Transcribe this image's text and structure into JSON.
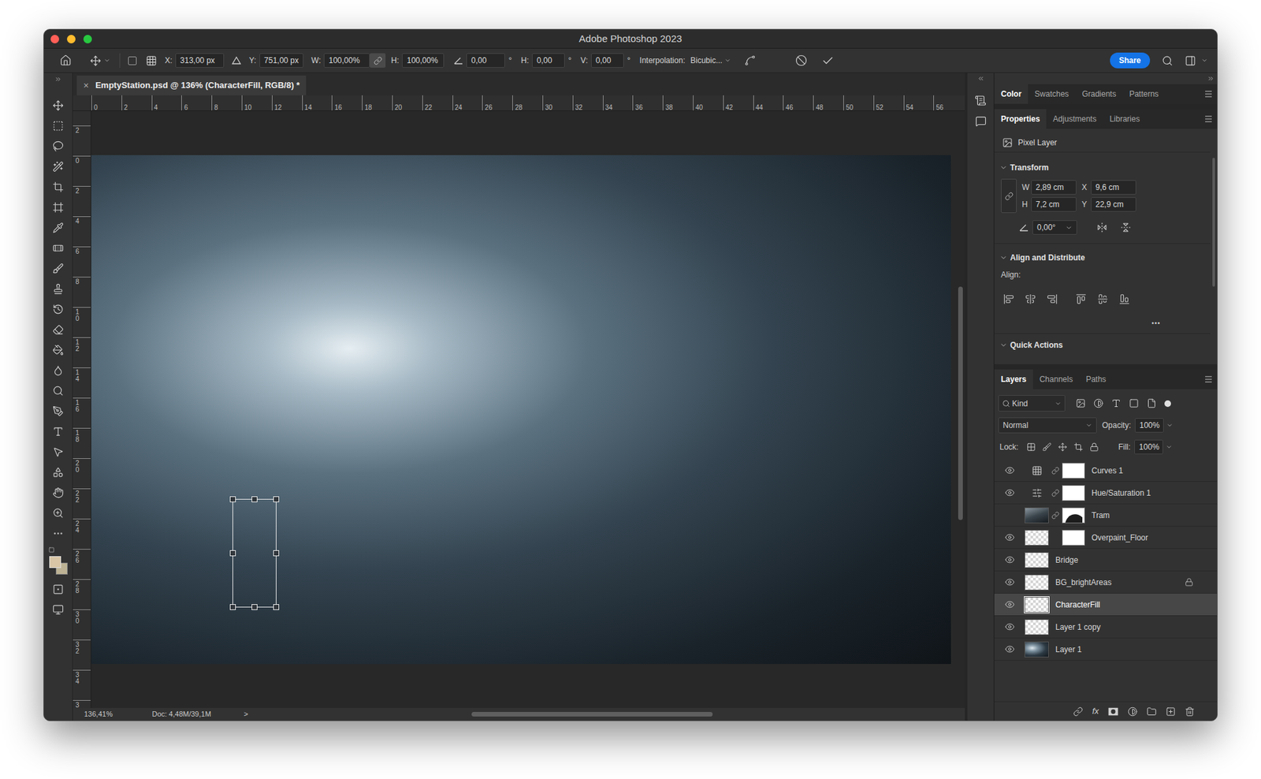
{
  "window": {
    "title": "Adobe Photoshop 2023",
    "controls": [
      {
        "color": "#ff5f57"
      },
      {
        "color": "#febc2e"
      },
      {
        "color": "#28c840"
      }
    ]
  },
  "options_bar": {
    "position": [
      {
        "label": "X:",
        "value": "313,00 px"
      },
      {
        "label": "Y:",
        "value": "751,00 px"
      }
    ],
    "size": [
      {
        "label": "W:",
        "value": "100,00%"
      },
      {
        "label": "H:",
        "value": "100,00%"
      }
    ],
    "size_linked": true,
    "rotate": {
      "value": "0,00",
      "unit": "°"
    },
    "skew": [
      {
        "label": "H:",
        "value": "0,00",
        "unit": "°"
      },
      {
        "label": "V:",
        "value": "0,00",
        "unit": "°"
      }
    ],
    "interpolation": {
      "label": "Interpolation:",
      "value": "Bicubic..."
    },
    "share": "Share"
  },
  "tools": {
    "foreground": "#d8c6a6",
    "background": "#bdb394"
  },
  "document": {
    "tab": {
      "close": "×",
      "title": "EmptyStation.psd @ 136% (CharacterFill, RGB/8) *",
      "selected": true
    },
    "ruler_top": [
      "0",
      "2",
      "4",
      "6",
      "8",
      "10",
      "12",
      "14",
      "16",
      "18",
      "20",
      "22",
      "24",
      "26",
      "28",
      "30",
      "32",
      "34",
      "36",
      "38",
      "40",
      "42",
      "44",
      "46",
      "48",
      "50",
      "52",
      "54",
      "56"
    ],
    "ruler_left": [
      "2",
      "0",
      "2",
      "4",
      "6",
      "8",
      "10",
      "12",
      "14",
      "16",
      "18",
      "20",
      "22",
      "24",
      "26",
      "28",
      "30",
      "32",
      "34",
      "3"
    ],
    "transform_active": true
  },
  "status_bar": {
    "zoom": "136,41%",
    "doc": "Doc: 4,48M/39,1M",
    "arrow": ">"
  },
  "color_panel": {
    "tabs": [
      {
        "label": "Color",
        "selected": true
      },
      {
        "label": "Swatches",
        "selected": false
      },
      {
        "label": "Gradients",
        "selected": false
      },
      {
        "label": "Patterns",
        "selected": false
      }
    ]
  },
  "properties_panel": {
    "tabs": [
      {
        "label": "Properties",
        "selected": true
      },
      {
        "label": "Adjustments",
        "selected": false
      },
      {
        "label": "Libraries",
        "selected": false
      }
    ],
    "layer_type": "Pixel Layer",
    "transform": {
      "title": "Transform",
      "expanded": true,
      "linked": false,
      "fields": [
        {
          "label": "W",
          "value": "2,89 cm"
        },
        {
          "label": "X",
          "value": "9,6 cm"
        },
        {
          "label": "H",
          "value": "7,2 cm"
        },
        {
          "label": "Y",
          "value": "22,9 cm"
        }
      ],
      "angle": "0,00°"
    },
    "align": {
      "title": "Align and Distribute",
      "expanded": true,
      "label": "Align:",
      "more": "•••"
    },
    "quick_actions": {
      "title": "Quick Actions",
      "expanded": true
    }
  },
  "layers_panel": {
    "tabs": [
      {
        "label": "Layers",
        "selected": true
      },
      {
        "label": "Channels",
        "selected": false
      },
      {
        "label": "Paths",
        "selected": false
      }
    ],
    "filter": "Kind",
    "blend_mode": "Normal",
    "opacity": {
      "label": "Opacity:",
      "value": "100%"
    },
    "lock_label": "Lock:",
    "fill": {
      "label": "Fill:",
      "value": "100%"
    },
    "fx": "fx",
    "layers": [
      {
        "name": "Curves 1",
        "visible": true,
        "selected": false,
        "locked": false,
        "kind": "curves",
        "linked": true,
        "mask": "plain"
      },
      {
        "name": "Hue/Saturation 1",
        "visible": true,
        "selected": false,
        "locked": false,
        "kind": "hue",
        "linked": true,
        "mask": "plain"
      },
      {
        "name": "Tram",
        "visible": false,
        "selected": false,
        "locked": false,
        "kind": "image",
        "linked": true,
        "mask": "shape"
      },
      {
        "name": "Overpaint_Floor",
        "visible": true,
        "selected": false,
        "locked": false,
        "kind": "pixel",
        "linked": false,
        "mask": "plain"
      },
      {
        "name": "Bridge",
        "visible": true,
        "selected": false,
        "locked": false,
        "kind": "pixel",
        "linked": false,
        "mask": "none"
      },
      {
        "name": "BG_brightAreas",
        "visible": true,
        "selected": false,
        "locked": true,
        "kind": "pixel",
        "linked": false,
        "mask": "none"
      },
      {
        "name": "CharacterFill",
        "visible": true,
        "selected": true,
        "locked": false,
        "kind": "pixel",
        "linked": false,
        "mask": "none"
      },
      {
        "name": "Layer 1 copy",
        "visible": true,
        "selected": false,
        "locked": false,
        "kind": "pixel",
        "linked": false,
        "mask": "none"
      },
      {
        "name": "Layer 1",
        "visible": true,
        "selected": false,
        "locked": false,
        "kind": "photo",
        "linked": false,
        "mask": "none"
      }
    ]
  }
}
